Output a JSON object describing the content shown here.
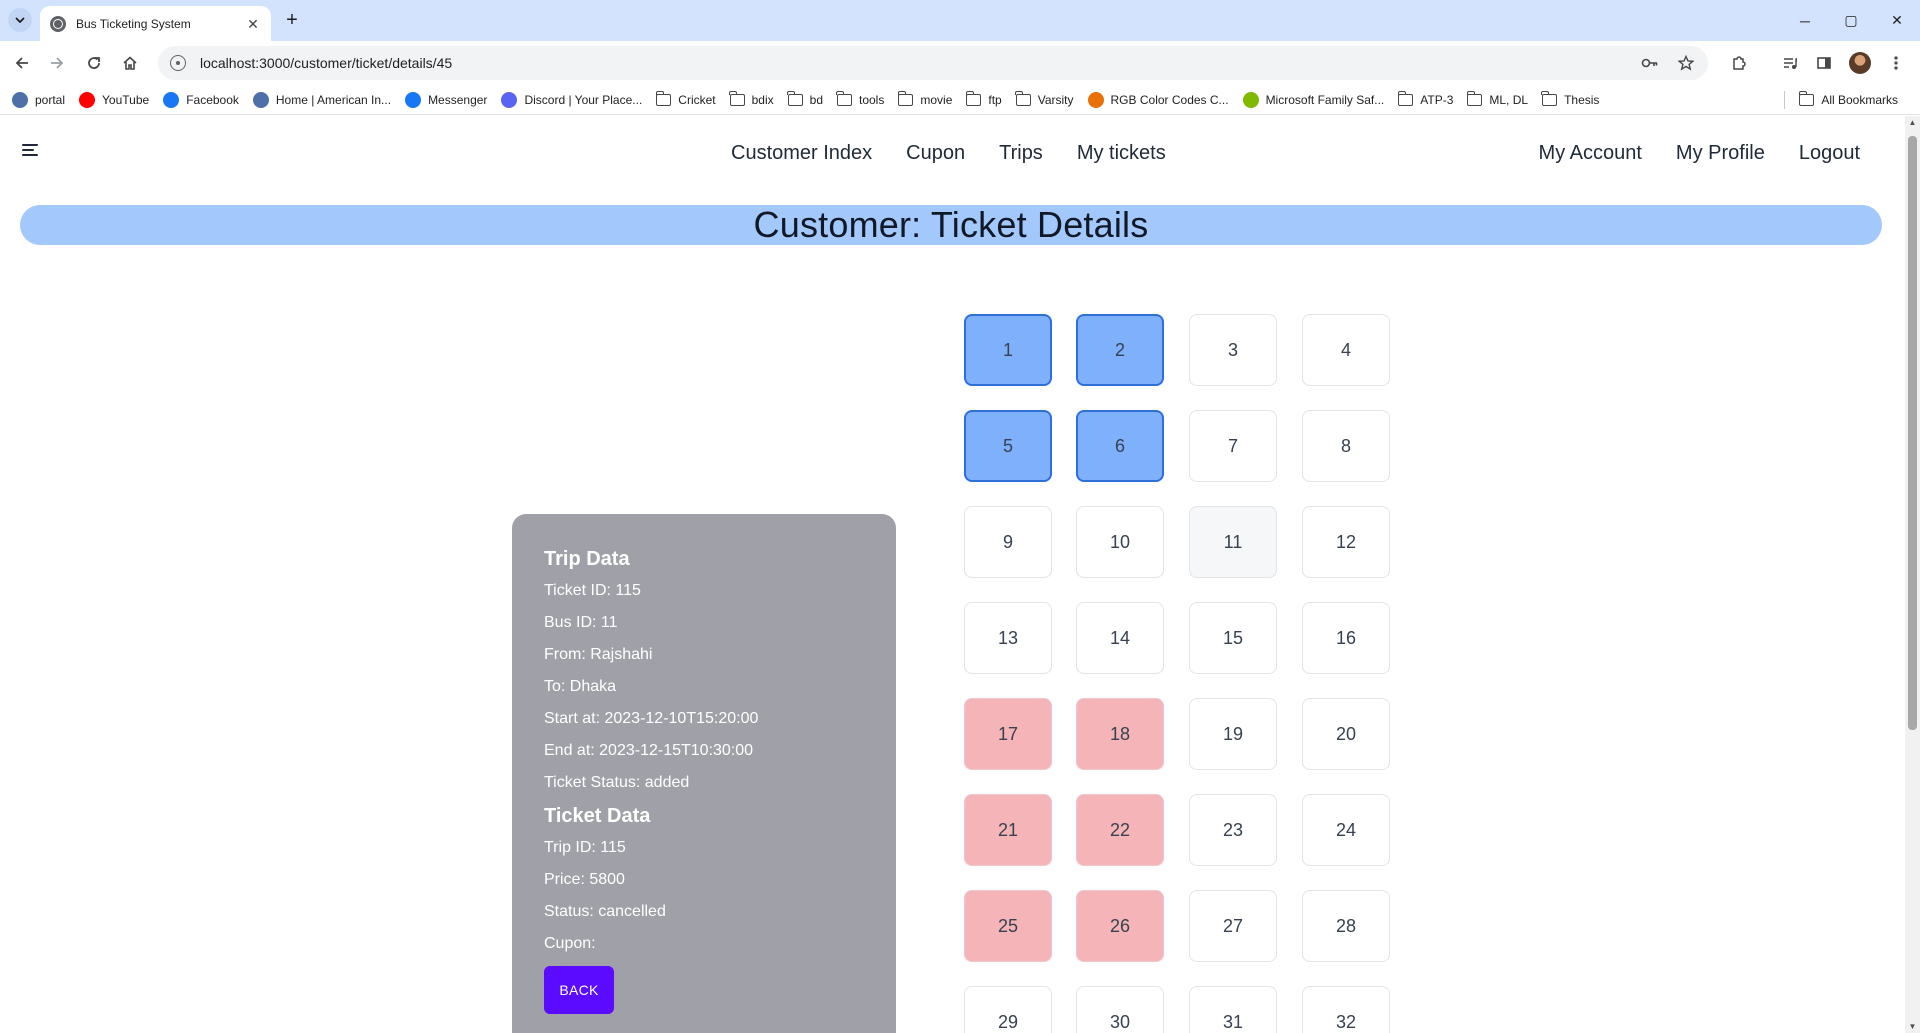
{
  "browser": {
    "tab_title": "Bus Ticketing System",
    "tab_close": "✕",
    "new_tab": "+",
    "url": "localhost:3000/customer/ticket/details/45",
    "window_controls": {
      "minimize": "─",
      "maximize": "▢",
      "close": "✕"
    },
    "bookmarks": [
      {
        "label": "portal",
        "icon": "portal-icon",
        "color": "#4f6fa8",
        "kind": "site"
      },
      {
        "label": "YouTube",
        "icon": "youtube-icon",
        "color": "#ff0000",
        "kind": "site"
      },
      {
        "label": "Facebook",
        "icon": "facebook-icon",
        "color": "#1877f2",
        "kind": "site"
      },
      {
        "label": "Home | American In...",
        "icon": "globe-icon",
        "color": "#4f6fa8",
        "kind": "site"
      },
      {
        "label": "Messenger",
        "icon": "facebook-icon",
        "color": "#1877f2",
        "kind": "site"
      },
      {
        "label": "Discord | Your Place...",
        "icon": "discord-icon",
        "color": "#5865f2",
        "kind": "site"
      },
      {
        "label": "Cricket",
        "kind": "folder"
      },
      {
        "label": "bdix",
        "kind": "folder"
      },
      {
        "label": "bd",
        "kind": "folder"
      },
      {
        "label": "tools",
        "kind": "folder"
      },
      {
        "label": "movie",
        "kind": "folder"
      },
      {
        "label": "ftp",
        "kind": "folder"
      },
      {
        "label": "Varsity",
        "kind": "folder"
      },
      {
        "label": "RGB Color Codes C...",
        "icon": "rgb-icon",
        "color": "#e8710a",
        "kind": "site"
      },
      {
        "label": "Microsoft Family Saf...",
        "icon": "microsoft-icon",
        "color": "#7fba00",
        "kind": "site"
      },
      {
        "label": "ATP-3",
        "kind": "folder"
      },
      {
        "label": "ML, DL",
        "kind": "folder"
      },
      {
        "label": "Thesis",
        "kind": "folder"
      }
    ],
    "all_bookmarks": "All Bookmarks"
  },
  "nav": {
    "center": [
      "Customer Index",
      "Cupon",
      "Trips",
      "My tickets"
    ],
    "right": [
      "My Account",
      "My Profile",
      "Logout"
    ]
  },
  "page_title": "Customer: Ticket Details",
  "trip": {
    "heading": "Trip Data",
    "ticket_id": "Ticket ID: 115",
    "bus_id": "Bus ID: 11",
    "from": "From: Rajshahi",
    "to": "To: Dhaka",
    "start": "Start at: 2023-12-10T15:20:00",
    "end": "End at: 2023-12-15T10:30:00",
    "ticket_status": "Ticket Status: added"
  },
  "ticket": {
    "heading": "Ticket Data",
    "trip_id": "Trip ID: 115",
    "price": "Price: 5800",
    "status": "Status: cancelled",
    "cupon": "Cupon:"
  },
  "back_label": "BACK",
  "seats": [
    {
      "n": "1",
      "state": "booked"
    },
    {
      "n": "2",
      "state": "booked"
    },
    {
      "n": "3",
      "state": "free"
    },
    {
      "n": "4",
      "state": "free"
    },
    {
      "n": "5",
      "state": "booked"
    },
    {
      "n": "6",
      "state": "booked"
    },
    {
      "n": "7",
      "state": "free"
    },
    {
      "n": "8",
      "state": "free"
    },
    {
      "n": "9",
      "state": "free"
    },
    {
      "n": "10",
      "state": "free"
    },
    {
      "n": "11",
      "state": "hover"
    },
    {
      "n": "12",
      "state": "free"
    },
    {
      "n": "13",
      "state": "free"
    },
    {
      "n": "14",
      "state": "free"
    },
    {
      "n": "15",
      "state": "free"
    },
    {
      "n": "16",
      "state": "free"
    },
    {
      "n": "17",
      "state": "sold"
    },
    {
      "n": "18",
      "state": "sold"
    },
    {
      "n": "19",
      "state": "free"
    },
    {
      "n": "20",
      "state": "free"
    },
    {
      "n": "21",
      "state": "sold"
    },
    {
      "n": "22",
      "state": "sold"
    },
    {
      "n": "23",
      "state": "free"
    },
    {
      "n": "24",
      "state": "free"
    },
    {
      "n": "25",
      "state": "sold"
    },
    {
      "n": "26",
      "state": "sold"
    },
    {
      "n": "27",
      "state": "free"
    },
    {
      "n": "28",
      "state": "free"
    },
    {
      "n": "29",
      "state": "free"
    },
    {
      "n": "30",
      "state": "free"
    },
    {
      "n": "31",
      "state": "free"
    },
    {
      "n": "32",
      "state": "free"
    }
  ],
  "colors": {
    "title_bar": "#a3c8fb",
    "booked_seat": "#7fb0fb",
    "sold_seat": "#f5b4b8",
    "card": "#a0a1a8",
    "back_button": "#5b0bff"
  }
}
